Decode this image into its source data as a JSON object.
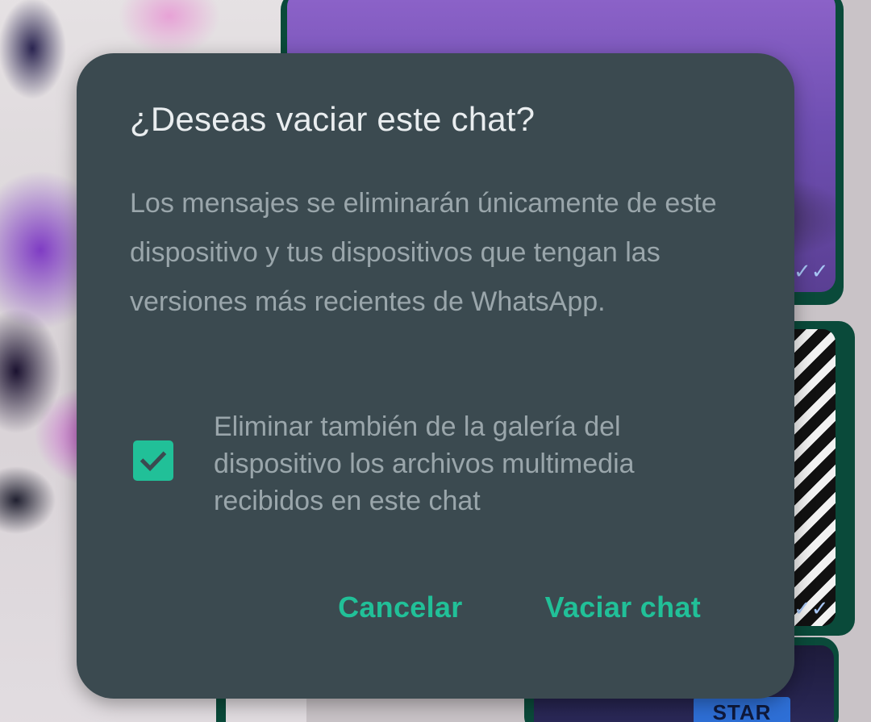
{
  "dialog": {
    "title": "¿Deseas vaciar este chat?",
    "message": "Los mensajes se eliminarán únicamente de este dispositivo y tus dispositivos que tengan las versiones más recientes de WhatsApp.",
    "checkbox": {
      "label": "Eliminar también de la galería del dispositivo los archivos multimedia recibidos en este chat",
      "checked": true
    },
    "actions": {
      "cancel_label": "Cancelar",
      "confirm_label": "Vaciar chat"
    }
  },
  "background": {
    "sticker_text": "STAR"
  },
  "colors": {
    "dialog_bg": "#3b4a50",
    "title_text": "#e9edef",
    "body_text": "#9aa6ab",
    "accent": "#21c098"
  },
  "icons": {
    "checkbox": "check-icon",
    "read_receipt": "double-check-icon"
  }
}
